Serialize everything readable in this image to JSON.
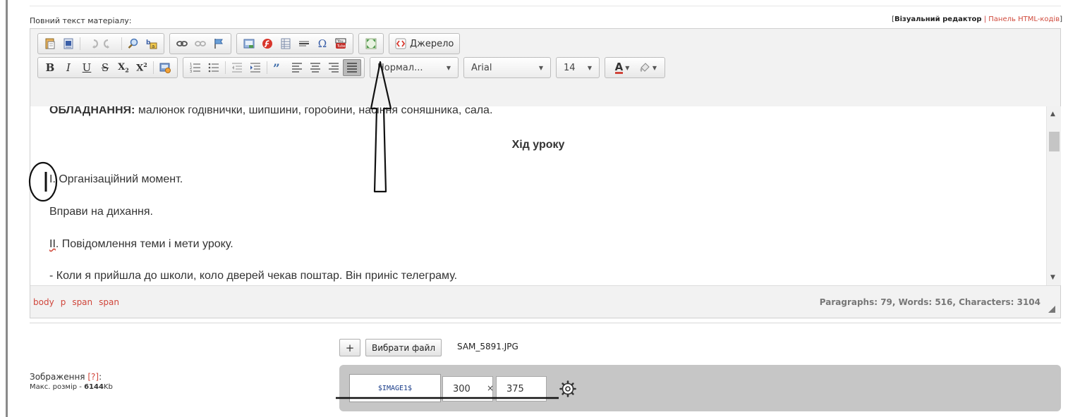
{
  "form": {
    "field_label": "Повний текст матеріалу:",
    "editor_switch": {
      "bracket_open": "[",
      "visual": "Візуальний редактор",
      "separator": "|",
      "html": "Панель HTML-кодів",
      "bracket_close": "]"
    }
  },
  "toolbar": {
    "source_label": "Джерело",
    "bold": "B",
    "italic": "I",
    "underline": "U",
    "strike": "S",
    "subscript": "X",
    "subscript_mark": "2",
    "superscript": "X",
    "superscript_mark": "2",
    "format_select": "Нормал...",
    "font_select": "Arial",
    "size_select": "14",
    "text_color_glyph": "A",
    "icons": [
      "paste-text-icon",
      "paste-word-icon",
      "undo-icon",
      "redo-icon",
      "find-icon",
      "replace-icon",
      "link-icon",
      "unlink-icon",
      "anchor-icon",
      "image-icon",
      "flash-icon",
      "table-icon",
      "horizontal-rule-icon",
      "special-char-icon",
      "youtube-icon",
      "maximize-icon",
      "source-icon",
      "insert-image-icon",
      "numbered-list-icon",
      "bulleted-list-icon",
      "outdent-icon",
      "indent-icon",
      "blockquote-icon",
      "align-left-icon",
      "align-center-icon",
      "align-right-icon",
      "justify-icon",
      "text-color-icon",
      "background-color-icon"
    ],
    "special_char_glyph": "Ω"
  },
  "content": {
    "line1_bold": "ОБЛАДНАННЯ:",
    "line1_rest": " малюнок годівнички, шипшини, горобини, насіння соняшника, сала.",
    "title": "Хід уроку",
    "line3": "I. Організаційний момент.",
    "line4": "Вправи на дихання.",
    "line5_roman": "II",
    "line5_rest": ". Повідомлення теми і мети уроку.",
    "line6": "- Коли я прийшла до школи, коло дверей чекав поштар. Він приніс телеграму."
  },
  "statusbar": {
    "crumbs": [
      "body",
      "p",
      "span",
      "span"
    ],
    "wordcount": "Paragraphs: 79, Words: 516, Characters: 3104"
  },
  "upload": {
    "add_label": "+",
    "choose_file_label": "Вибрати файл",
    "file_name": "SAM_5891.JPG",
    "image_label": "Зображення",
    "help_text": "[?]",
    "label_colon": ":",
    "max_size_prefix": "Макс. розмір - ",
    "max_size_value": "6144",
    "max_size_unit": "Kb",
    "image_code": "$IMAGE1$",
    "width": "300",
    "times": "×",
    "height": "375"
  },
  "colors": {
    "accent_red": "#d0453a",
    "link_blue": "#1a3d8a",
    "toolbar_bg": "#f2f2f2",
    "panel_gray": "#c6c6c6"
  }
}
